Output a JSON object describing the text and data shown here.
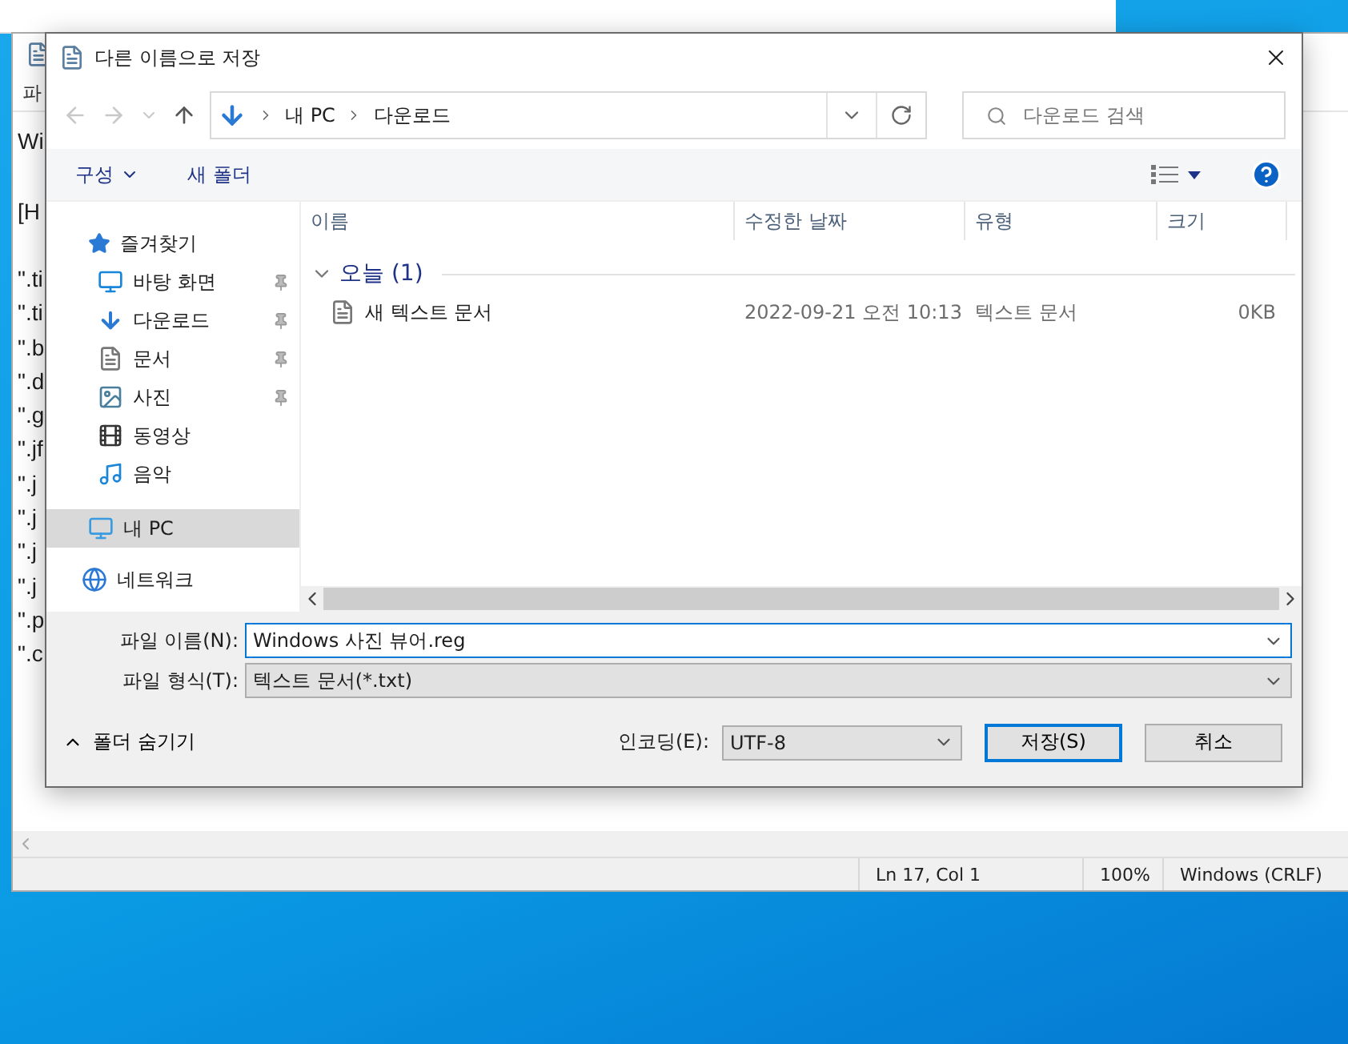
{
  "notepad": {
    "menu_fragment": "파",
    "header_lines": [
      "Wi",
      "[H"
    ],
    "lines": [
      "\".ti",
      "\".ti",
      "\".b",
      "\".d",
      "\".g",
      "\".jf",
      "\".j",
      "\".j",
      "\".j",
      "\".j",
      "\".p",
      "\".c"
    ],
    "status_bar": {
      "position": "Ln 17, Col 1",
      "zoom": "100%",
      "line_ending": "Windows (CRLF)"
    }
  },
  "dialog": {
    "title": "다른 이름으로 저장",
    "breadcrumb": [
      "내 PC",
      "다운로드"
    ],
    "search": {
      "placeholder": "다운로드 검색"
    },
    "toolbar": {
      "organize": "구성",
      "new_folder": "새 폴더"
    },
    "nav": [
      {
        "kind": "favorites",
        "label": "즐겨찾기",
        "pinned": false,
        "selected": false
      },
      {
        "kind": "desktop",
        "label": "바탕 화면",
        "pinned": true,
        "selected": false
      },
      {
        "kind": "downloads",
        "label": "다운로드",
        "pinned": true,
        "selected": false
      },
      {
        "kind": "documents",
        "label": "문서",
        "pinned": true,
        "selected": false
      },
      {
        "kind": "pictures",
        "label": "사진",
        "pinned": true,
        "selected": false
      },
      {
        "kind": "videos",
        "label": "동영상",
        "pinned": false,
        "selected": false
      },
      {
        "kind": "music",
        "label": "음악",
        "pinned": false,
        "selected": false
      },
      {
        "kind": "pc",
        "label": "내 PC",
        "pinned": false,
        "selected": true
      },
      {
        "kind": "network",
        "label": "네트워크",
        "pinned": false,
        "selected": false
      }
    ],
    "columns": [
      "이름",
      "수정한 날짜",
      "유형",
      "크기"
    ],
    "groups": [
      {
        "label": "오늘 (1)",
        "expanded": true,
        "rows": [
          {
            "name": "새 텍스트 문서",
            "modified": "2022-09-21 오전 10:13",
            "type": "텍스트 문서",
            "size": "0KB",
            "selected": false
          }
        ]
      }
    ],
    "file_name": {
      "label": "파일 이름(N):",
      "value": "Windows 사진 뷰어.reg"
    },
    "file_type": {
      "label": "파일 형식(T):",
      "value": "텍스트 문서(*.txt)"
    },
    "hide_folders": "폴더 숨기기",
    "encoding": {
      "label": "인코딩(E):",
      "value": "UTF-8"
    },
    "buttons": [
      "저장(S)",
      "취소"
    ]
  }
}
